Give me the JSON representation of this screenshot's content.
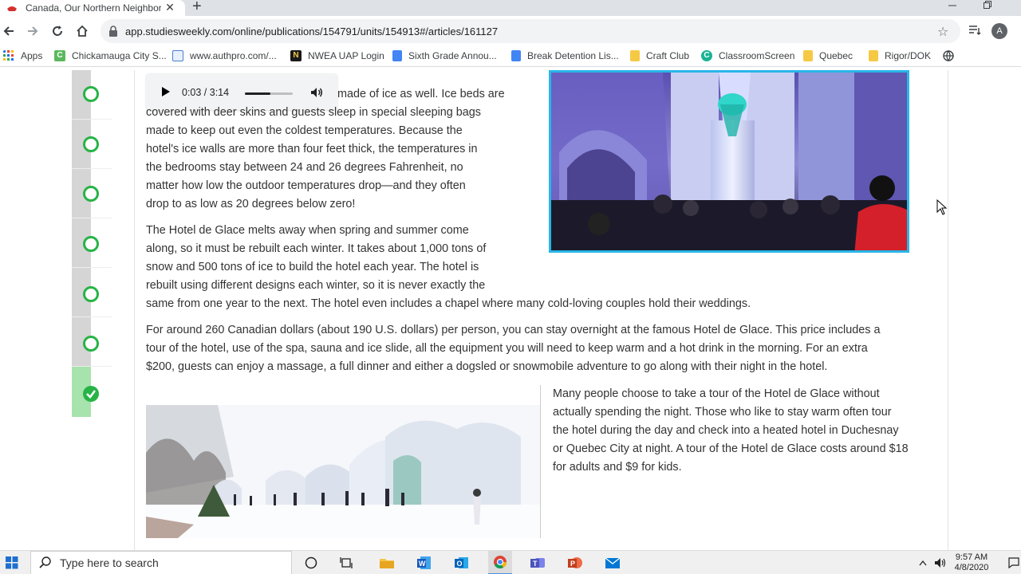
{
  "browser": {
    "tab_title": "Canada, Our Northern Neighbor",
    "tab_close": "✕",
    "new_tab": "+",
    "url": "app.studiesweekly.com/online/publications/154791/units/154913#/articles/161127",
    "profile_initial": "A"
  },
  "bookmarks": [
    {
      "label": "Apps",
      "icon": "apps-grid-icon"
    },
    {
      "label": "Chickamauga City S...",
      "icon": "green-c-icon",
      "color": "#5cb85c"
    },
    {
      "label": "www.authpro.com/...",
      "icon": "page-icon",
      "color": "#4a7fd1"
    },
    {
      "label": "NWEA UAP Login",
      "icon": "nwea-icon",
      "color": "#1a1a1a"
    },
    {
      "label": "Sixth Grade Annou...",
      "icon": "doc-icon",
      "color": "#4285f4"
    },
    {
      "label": "Break Detention Lis...",
      "icon": "doc-icon",
      "color": "#4285f4"
    },
    {
      "label": "Craft Club",
      "icon": "folder-icon",
      "color": "#f6c945"
    },
    {
      "label": "ClassroomScreen",
      "icon": "classroomscreen-icon",
      "color": "#1ab394"
    },
    {
      "label": "Quebec",
      "icon": "folder-icon",
      "color": "#f6c945"
    },
    {
      "label": "Rigor/DOK",
      "icon": "folder-icon",
      "color": "#f6c945"
    }
  ],
  "audio": {
    "time": "0:03 / 3:14",
    "progress_fraction": 0.016
  },
  "article": {
    "para1_lines": [
      "made of ice as well. Ice beds are",
      "covered with deer skins and guests sleep in special sleeping bags",
      "made to keep out even the coldest temperatures. Because the",
      "hotel's ice walls are more than four feet thick, the temperatures in",
      "the bedrooms stay between 24 and 26 degrees Fahrenheit, no",
      "matter how low the outdoor temperatures drop—and they often",
      "drop to as low as 20 degrees below zero!"
    ],
    "para2_lines": [
      "The Hotel de Glace melts away when spring and summer come",
      "along, so it must be rebuilt each winter. It takes about 1,000 tons of",
      "snow and 500 tons of ice to build the hotel each year. The hotel is",
      "rebuilt using different designs each winter, so it is never exactly the",
      "same from one year to the next. The hotel even includes a chapel where many cold-loving couples hold their weddings."
    ],
    "para3_lines": [
      "For around 260 Canadian dollars (about 190 U.S. dollars) per person, you can stay overnight at the famous Hotel de Glace. This price includes a",
      "tour of the hotel, use of the spa, sauna and ice slide, all the equipment you will need to keep warm and a hot drink in the morning. For an extra",
      "$200, guests can enjoy a massage, a full dinner and either a dogsled or snowmobile adventure to go along with their night in the hotel."
    ],
    "para4_lines": [
      "Many people choose to take a tour of the Hotel de Glace without",
      "actually spending the night. Those who like to stay warm often tour",
      "the hotel during the day and check into a heated hotel in Duchesnay",
      "or Quebec City at night. A tour of the Hotel de Glace costs around $18",
      "for adults and $9 for kids."
    ]
  },
  "progress_rail": {
    "steps": [
      {
        "state": "incomplete"
      },
      {
        "state": "incomplete"
      },
      {
        "state": "incomplete"
      },
      {
        "state": "incomplete"
      },
      {
        "state": "incomplete"
      },
      {
        "state": "incomplete"
      },
      {
        "state": "complete"
      }
    ],
    "accent": "#27b346"
  },
  "taskbar": {
    "search_placeholder": "Type here to search",
    "time": "9:57 AM",
    "date": "4/8/2020"
  }
}
